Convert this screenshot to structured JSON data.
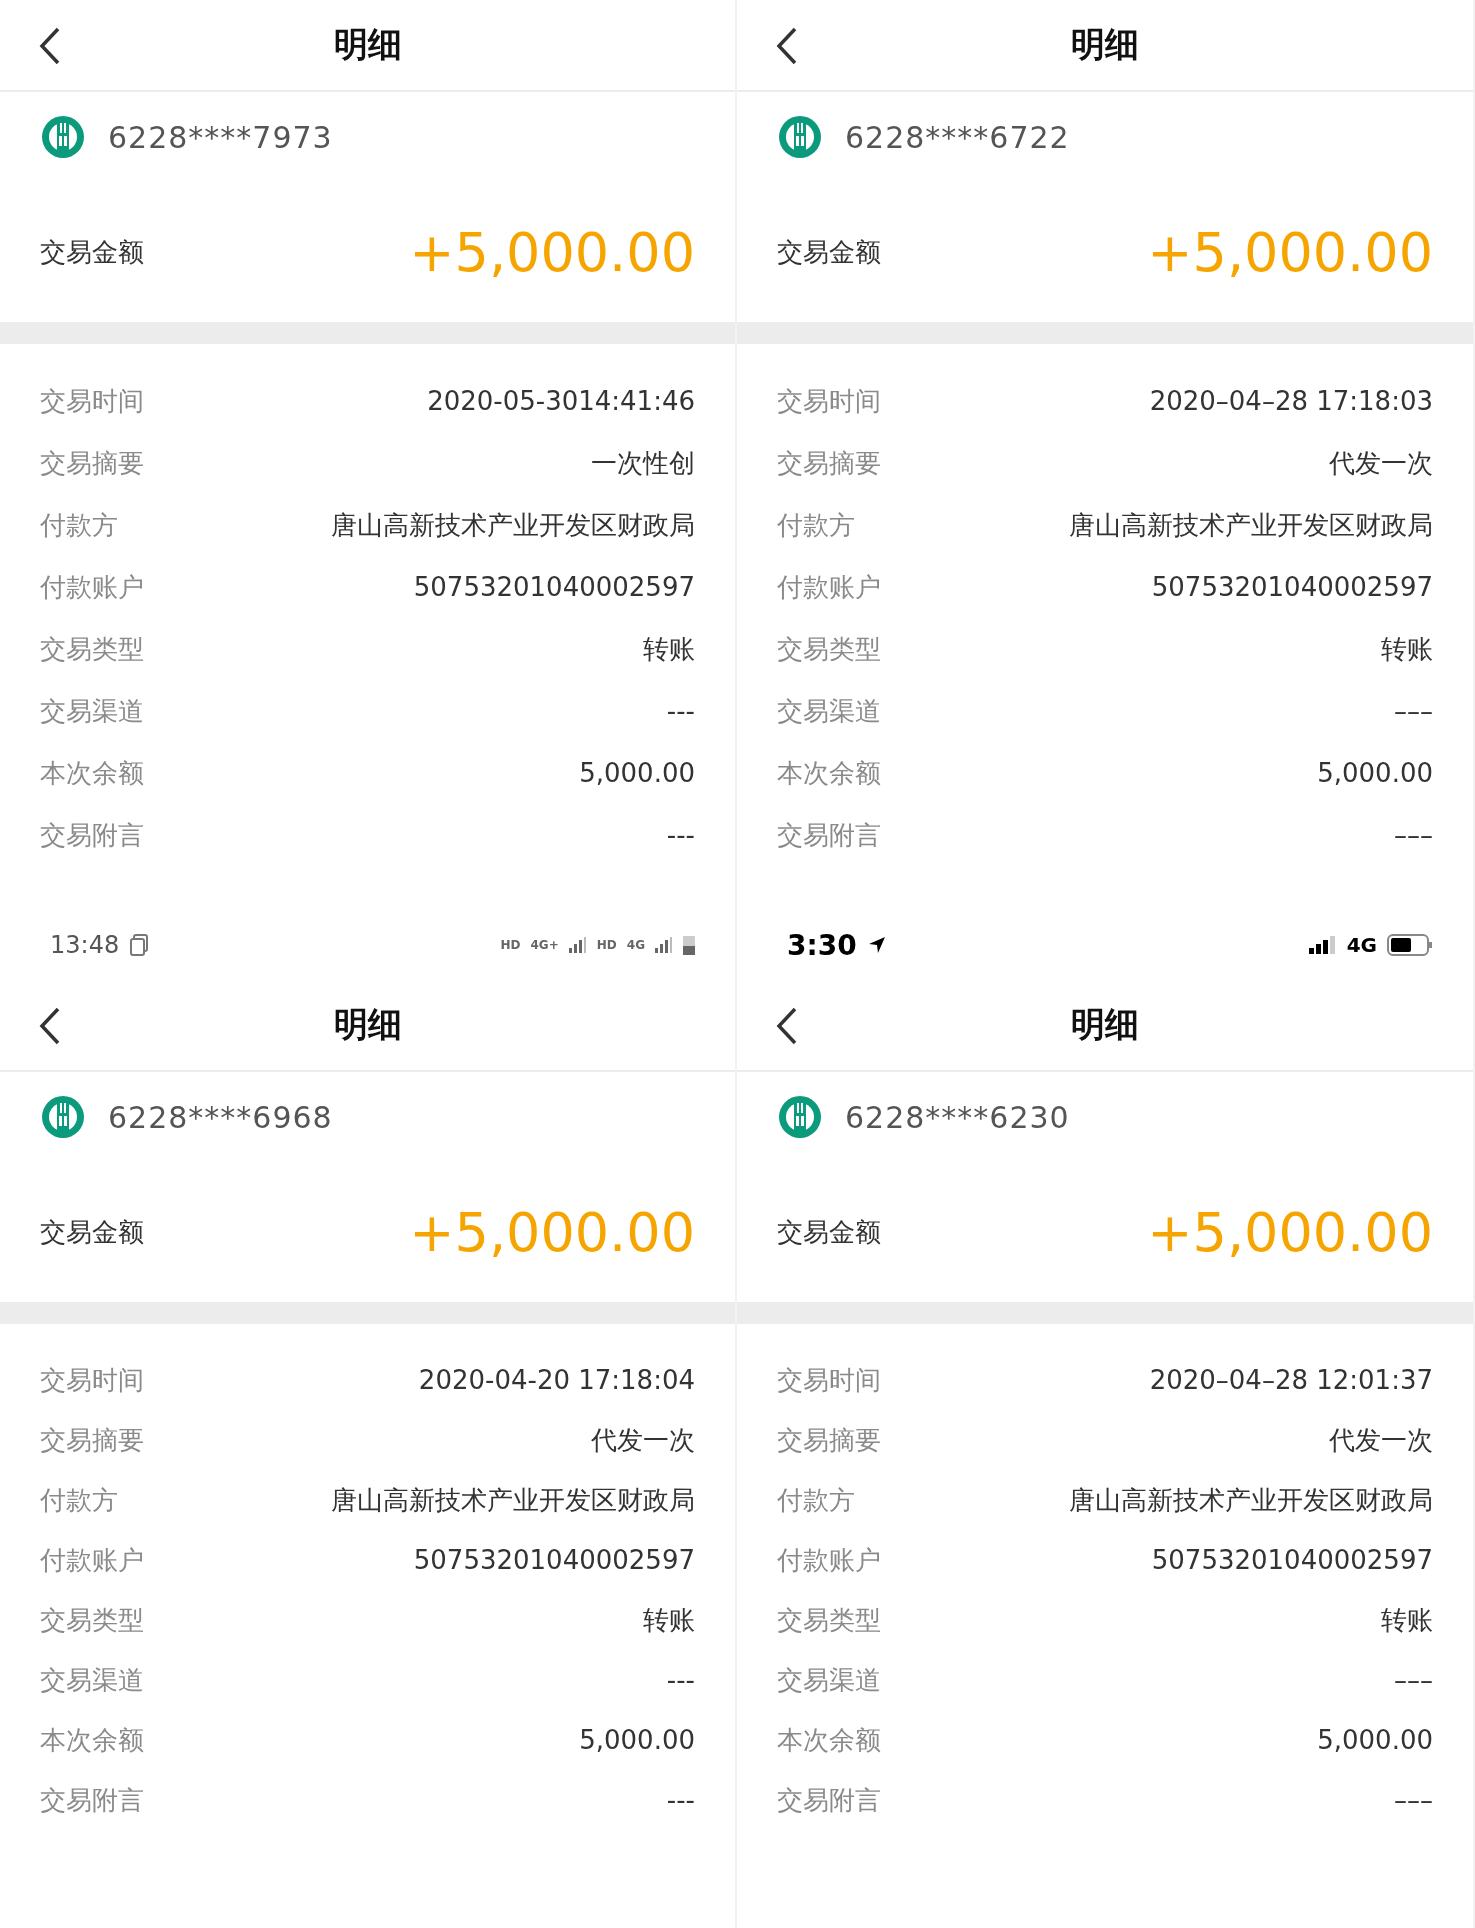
{
  "panels": [
    {
      "title": "明细",
      "card_number": "6228****7973",
      "amount_label": "交易金额",
      "amount": "+5,000.00",
      "details": [
        {
          "label": "交易时间",
          "value": "2020-05-3014:41:46"
        },
        {
          "label": "交易摘要",
          "value": "一次性创"
        },
        {
          "label": "付款方",
          "value": "唐山高新技术产业开发区财政局"
        },
        {
          "label": "付款账户",
          "value": "50753201040002597"
        },
        {
          "label": "交易类型",
          "value": "转账"
        },
        {
          "label": "交易渠道",
          "value": "---"
        },
        {
          "label": "本次余额",
          "value": "5,000.00"
        },
        {
          "label": "交易附言",
          "value": "---"
        }
      ]
    },
    {
      "title": "明细",
      "card_number": "6228****6722",
      "amount_label": "交易金额",
      "amount": "+5,000.00",
      "details": [
        {
          "label": "交易时间",
          "value": "2020–04–28 17:18:03"
        },
        {
          "label": "交易摘要",
          "value": "代发一次"
        },
        {
          "label": "付款方",
          "value": "唐山高新技术产业开发区财政局"
        },
        {
          "label": "付款账户",
          "value": "50753201040002597"
        },
        {
          "label": "交易类型",
          "value": "转账"
        },
        {
          "label": "交易渠道",
          "value": "–––"
        },
        {
          "label": "本次余额",
          "value": "5,000.00"
        },
        {
          "label": "交易附言",
          "value": "–––"
        }
      ]
    },
    {
      "status_bar": {
        "kind": "android",
        "time": "13:48",
        "labels": [
          "HD",
          "4G+",
          "HD",
          "4G"
        ]
      },
      "title": "明细",
      "card_number": "6228****6968",
      "amount_label": "交易金额",
      "amount": "+5,000.00",
      "details": [
        {
          "label": "交易时间",
          "value": "2020-04-20 17:18:04"
        },
        {
          "label": "交易摘要",
          "value": "代发一次"
        },
        {
          "label": "付款方",
          "value": "唐山高新技术产业开发区财政局"
        },
        {
          "label": "付款账户",
          "value": "50753201040002597"
        },
        {
          "label": "交易类型",
          "value": "转账"
        },
        {
          "label": "交易渠道",
          "value": "---"
        },
        {
          "label": "本次余额",
          "value": "5,000.00"
        },
        {
          "label": "交易附言",
          "value": "---"
        }
      ]
    },
    {
      "status_bar": {
        "kind": "ios",
        "time": "3:30",
        "labels": [
          "4G"
        ]
      },
      "title": "明细",
      "card_number": "6228****6230",
      "amount_label": "交易金额",
      "amount": "+5,000.00",
      "details": [
        {
          "label": "交易时间",
          "value": "2020–04–28 12:01:37"
        },
        {
          "label": "交易摘要",
          "value": "代发一次"
        },
        {
          "label": "付款方",
          "value": "唐山高新技术产业开发区财政局"
        },
        {
          "label": "付款账户",
          "value": "50753201040002597"
        },
        {
          "label": "交易类型",
          "value": "转账"
        },
        {
          "label": "交易渠道",
          "value": "–––"
        },
        {
          "label": "本次余额",
          "value": "5,000.00"
        },
        {
          "label": "交易附言",
          "value": "–––"
        }
      ]
    }
  ]
}
